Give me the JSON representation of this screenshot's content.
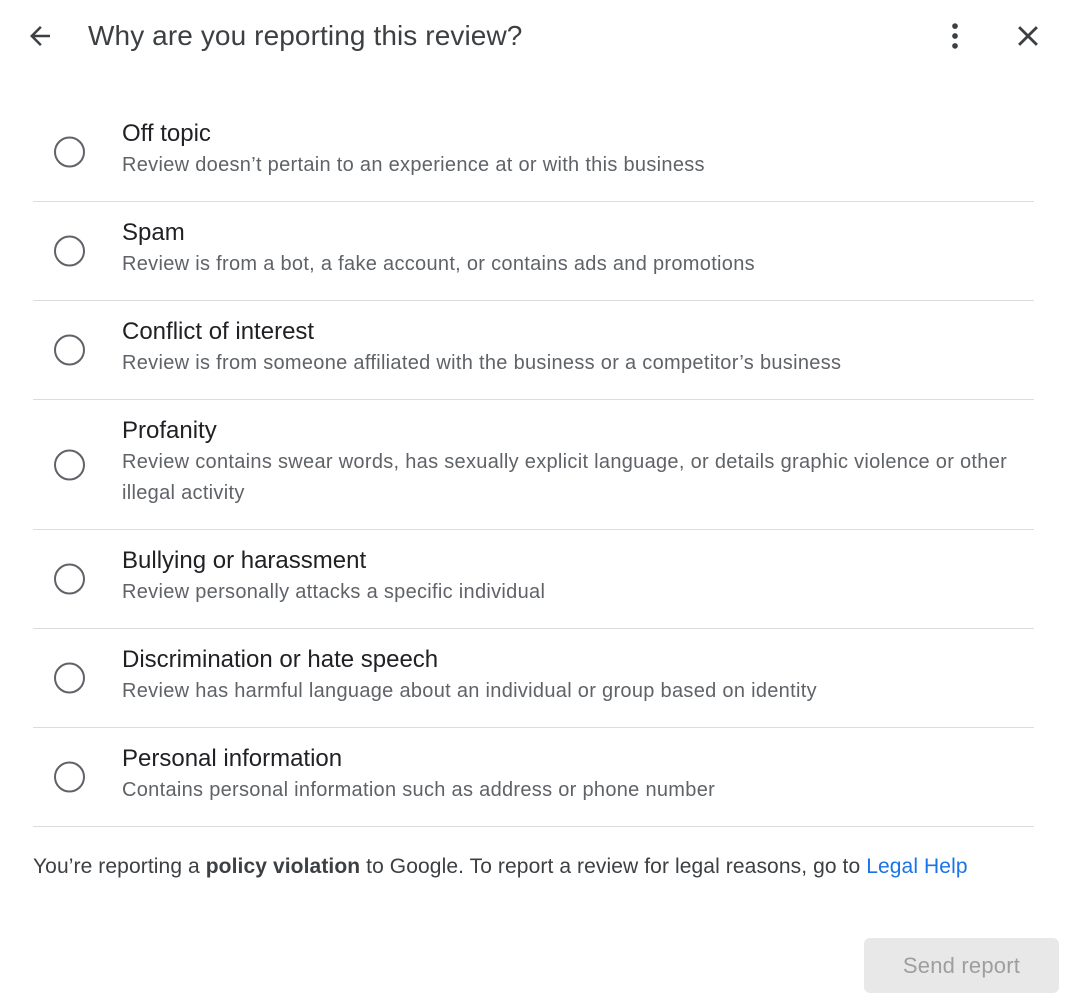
{
  "header": {
    "title": "Why are you reporting this review?",
    "back_icon": "arrow-back-icon",
    "more_icon": "more-vert-icon",
    "close_icon": "close-icon"
  },
  "options": [
    {
      "label": "Off topic",
      "description": "Review doesn’t pertain to an experience at or with this business",
      "selected": false
    },
    {
      "label": "Spam",
      "description": "Review is from a bot, a fake account, or contains ads and promotions",
      "selected": false
    },
    {
      "label": "Conflict of interest",
      "description": "Review is from someone affiliated with the business or a competitor’s business",
      "selected": false
    },
    {
      "label": "Profanity",
      "description": "Review contains swear words, has sexually explicit language, or details graphic violence or other illegal activity",
      "selected": false
    },
    {
      "label": "Bullying or harassment",
      "description": "Review personally attacks a specific individual",
      "selected": false
    },
    {
      "label": "Discrimination or hate speech",
      "description": "Review has harmful language about an individual or group based on identity",
      "selected": false
    },
    {
      "label": "Personal information",
      "description": "Contains personal information such as address or phone number",
      "selected": false
    }
  ],
  "footer": {
    "note_prefix": "You’re reporting a ",
    "note_bold": "policy violation",
    "note_suffix": " to Google. To report a review for legal reasons, go to ",
    "link_label": "Legal Help",
    "link_color": "#1a73e8"
  },
  "actions": {
    "send_label": "Send report",
    "send_disabled": true
  }
}
